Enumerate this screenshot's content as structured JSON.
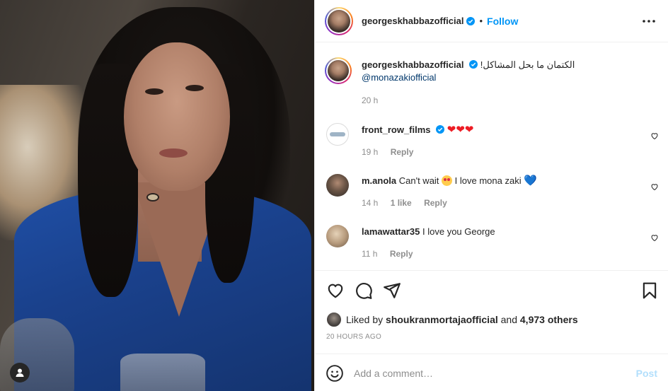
{
  "post": {
    "author": "georgeskhabbazofficial",
    "follow_label": "Follow",
    "separator": "•",
    "caption_text": "الكتمان ما بحل المشاكل!",
    "caption_mention": "@monazakiofficial",
    "caption_time": "20 h"
  },
  "comments": [
    {
      "user": "front_row_films",
      "verified": true,
      "text": "",
      "emoji": "❤❤❤",
      "time": "19 h",
      "likes": "",
      "reply": "Reply"
    },
    {
      "user": "m.anola",
      "verified": false,
      "text": "Can't wait",
      "text2": "I love mona zaki",
      "emoji_end": "💙",
      "time": "14 h",
      "likes": "1 like",
      "reply": "Reply"
    },
    {
      "user": "lamawattar35",
      "verified": false,
      "text": "I love you George",
      "time": "11 h",
      "likes": "",
      "reply": "Reply"
    }
  ],
  "likes": {
    "prefix": "Liked by",
    "user": "shoukranmortajaofficial",
    "and": "and",
    "others": "4,973 others",
    "time_ago": "20 HOURS AGO"
  },
  "add_comment": {
    "placeholder": "Add a comment…",
    "post_label": "Post"
  },
  "colors": {
    "accent": "#0095f6",
    "post_disabled": "#b2dffc",
    "secondary_text": "#8e8e8e",
    "border": "#efefef"
  },
  "icons": [
    "verified-badge-icon",
    "more-options-icon",
    "heart-icon",
    "comment-icon",
    "share-icon",
    "bookmark-icon",
    "emoji-icon",
    "user-tag-icon"
  ]
}
